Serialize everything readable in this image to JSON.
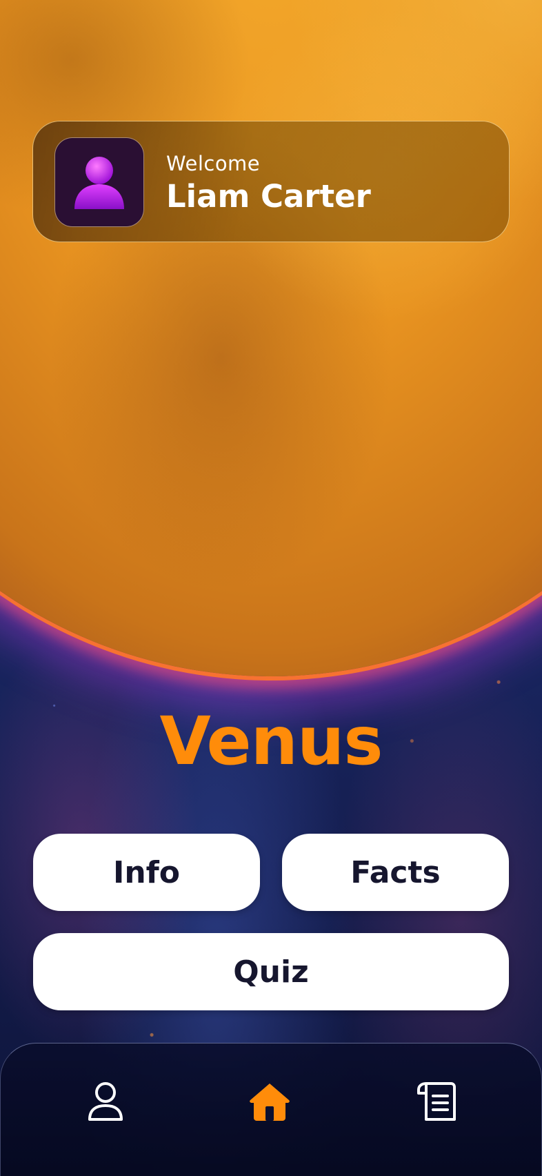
{
  "header": {
    "welcome_label": "Welcome",
    "user_name": "Liam Carter",
    "avatar_icon": "user-avatar-icon"
  },
  "main": {
    "planet_name": "Venus",
    "buttons": {
      "info": "Info",
      "facts": "Facts",
      "quiz": "Quiz"
    }
  },
  "nav": {
    "items": [
      {
        "icon": "profile-icon",
        "active": false
      },
      {
        "icon": "home-icon",
        "active": true
      },
      {
        "icon": "notes-icon",
        "active": false
      }
    ]
  },
  "colors": {
    "accent": "#ff8c0a",
    "button_text": "#16162e",
    "nav_icon": "#ffffff"
  }
}
